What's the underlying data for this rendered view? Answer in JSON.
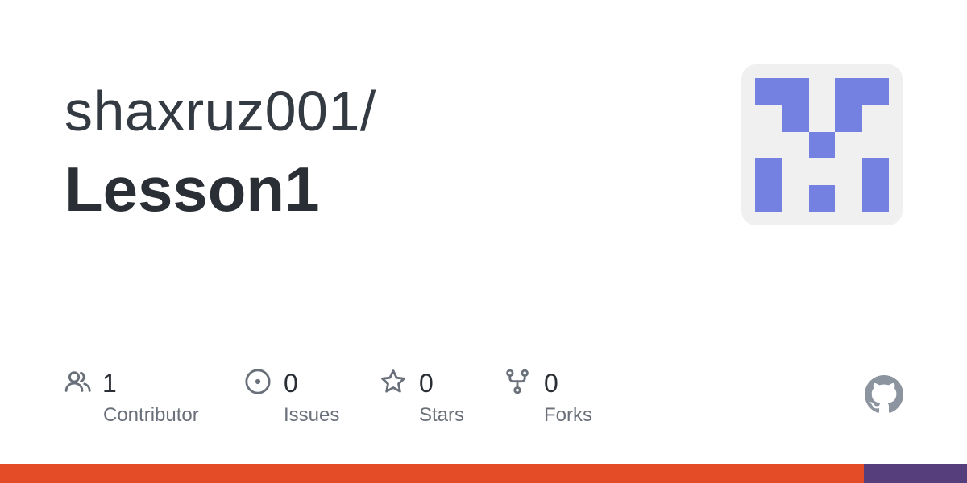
{
  "repo": {
    "owner_prefix": "shaxruz001/",
    "name": "Lesson1"
  },
  "avatar": {
    "icon": "identicon",
    "foreground": "#7481e0",
    "background": "#f0f0f0"
  },
  "stats": [
    {
      "icon": "people-icon",
      "value": "1",
      "label": "Contributor"
    },
    {
      "icon": "issue-opened-icon",
      "value": "0",
      "label": "Issues"
    },
    {
      "icon": "star-icon",
      "value": "0",
      "label": "Stars"
    },
    {
      "icon": "repo-forked-icon",
      "value": "0",
      "label": "Forks"
    }
  ],
  "footer": {
    "logo_icon": "github-mark-icon",
    "language_bar": [
      {
        "color": "#e34c26",
        "fraction": 0.893
      },
      {
        "color": "#563d7c",
        "fraction": 0.107
      }
    ]
  },
  "colors": {
    "text_primary": "#2a2f35",
    "text_muted": "#6a7079",
    "icon_gray": "#6a7079",
    "logo_gray": "#8c959f"
  }
}
